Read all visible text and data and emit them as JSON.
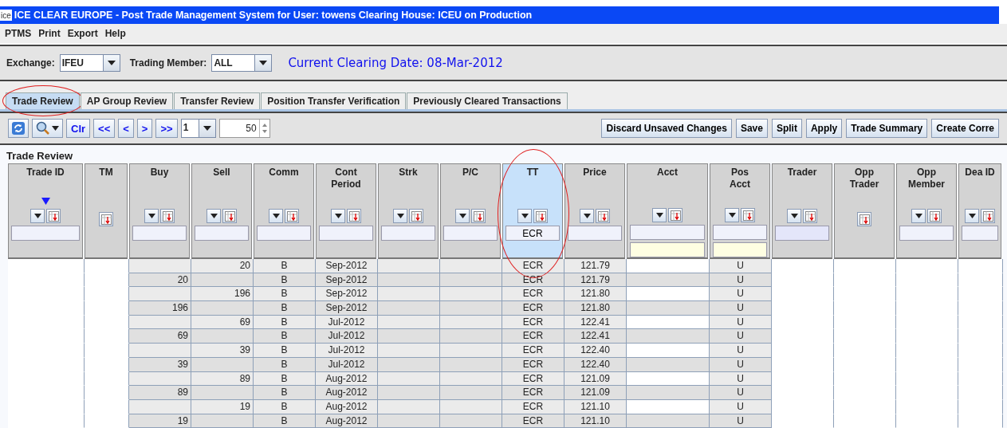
{
  "window": {
    "logo_text": "ice",
    "title": "ICE CLEAR EUROPE - Post Trade Management System for  User: towens Clearing House: ICEU on Production"
  },
  "menu": [
    "PTMS",
    "Print",
    "Export",
    "Help"
  ],
  "filters": {
    "exchange_label": "Exchange:",
    "exchange_value": "IFEU",
    "member_label": "Trading Member:",
    "member_value": "ALL",
    "clearing_date": "Current Clearing Date: 08-Mar-2012"
  },
  "tabs": [
    {
      "label": "Trade Review",
      "selected": true,
      "annotated": true
    },
    {
      "label": "AP Group Review",
      "selected": false,
      "annotated": false
    },
    {
      "label": "Transfer Review",
      "selected": false,
      "annotated": false
    },
    {
      "label": "Position Transfer Verification",
      "selected": false,
      "annotated": false
    },
    {
      "label": "Previously Cleared Transactions",
      "selected": false,
      "annotated": false
    }
  ],
  "toolbar": {
    "nav_buttons": [
      "Clr",
      "<<",
      "<",
      ">",
      ">>"
    ],
    "page": "1",
    "page_size": "50",
    "actions": [
      "Discard Unsaved Changes",
      "Save",
      "Split",
      "Apply",
      "Trade Summary",
      "Create Corre"
    ]
  },
  "panel_title": "Trade Review",
  "columns": [
    {
      "label": "Trade ID",
      "filterable": true,
      "sorted": true,
      "extra_field": false,
      "selected": false,
      "annotated": false
    },
    {
      "label": "TM",
      "filterable": false,
      "sorted": false,
      "extra_field": false,
      "selected": false,
      "annotated": false
    },
    {
      "label": "Buy",
      "filterable": true,
      "sorted": false,
      "extra_field": false,
      "selected": false,
      "annotated": false
    },
    {
      "label": "Sell",
      "filterable": true,
      "sorted": false,
      "extra_field": false,
      "selected": false,
      "annotated": false
    },
    {
      "label": "Comm",
      "filterable": true,
      "sorted": false,
      "extra_field": false,
      "selected": false,
      "annotated": false
    },
    {
      "label": "Cont Period",
      "filterable": true,
      "sorted": false,
      "extra_field": false,
      "selected": false,
      "annotated": false
    },
    {
      "label": "Strk",
      "filterable": true,
      "sorted": false,
      "extra_field": false,
      "selected": false,
      "annotated": false
    },
    {
      "label": "P/C",
      "filterable": true,
      "sorted": false,
      "extra_field": false,
      "selected": false,
      "annotated": false
    },
    {
      "label": "TT",
      "filterable": true,
      "sorted": false,
      "extra_field": false,
      "selected": true,
      "annotated": true,
      "filter_value": "ECR"
    },
    {
      "label": "Price",
      "filterable": true,
      "sorted": false,
      "extra_field": false,
      "selected": false,
      "annotated": false
    },
    {
      "label": "Acct",
      "filterable": true,
      "sorted": false,
      "extra_field": true,
      "selected": false,
      "annotated": false
    },
    {
      "label": "Pos Acct",
      "filterable": true,
      "sorted": false,
      "extra_field": true,
      "selected": false,
      "annotated": false
    },
    {
      "label": "Trader",
      "filterable": true,
      "sorted": false,
      "extra_field": false,
      "selected": false,
      "annotated": false
    },
    {
      "label": "Opp Trader",
      "filterable": false,
      "sorted": false,
      "extra_field": false,
      "selected": false,
      "annotated": false
    },
    {
      "label": "Opp Member",
      "filterable": true,
      "sorted": false,
      "extra_field": false,
      "selected": false,
      "annotated": false
    },
    {
      "label": "Dea ID",
      "filterable": true,
      "sorted": false,
      "extra_field": false,
      "selected": false,
      "annotated": false
    }
  ],
  "rows": [
    {
      "sell": "20",
      "comm": "B",
      "cont_period": "Sep-2012",
      "tt": "ECR",
      "price": "121.79",
      "pos_acct": "U"
    },
    {
      "buy": "20",
      "comm": "B",
      "cont_period": "Sep-2012",
      "tt": "ECR",
      "price": "121.79",
      "pos_acct": "U"
    },
    {
      "sell": "196",
      "comm": "B",
      "cont_period": "Sep-2012",
      "tt": "ECR",
      "price": "121.80",
      "pos_acct": "U"
    },
    {
      "buy": "196",
      "comm": "B",
      "cont_period": "Sep-2012",
      "tt": "ECR",
      "price": "121.80",
      "pos_acct": "U"
    },
    {
      "sell": "69",
      "comm": "B",
      "cont_period": "Jul-2012",
      "tt": "ECR",
      "price": "122.41",
      "pos_acct": "U"
    },
    {
      "buy": "69",
      "comm": "B",
      "cont_period": "Jul-2012",
      "tt": "ECR",
      "price": "122.41",
      "pos_acct": "U"
    },
    {
      "sell": "39",
      "comm": "B",
      "cont_period": "Jul-2012",
      "tt": "ECR",
      "price": "122.40",
      "pos_acct": "U"
    },
    {
      "buy": "39",
      "comm": "B",
      "cont_period": "Jul-2012",
      "tt": "ECR",
      "price": "122.40",
      "pos_acct": "U"
    },
    {
      "sell": "89",
      "comm": "B",
      "cont_period": "Aug-2012",
      "tt": "ECR",
      "price": "121.09",
      "pos_acct": "U"
    },
    {
      "buy": "89",
      "comm": "B",
      "cont_period": "Aug-2012",
      "tt": "ECR",
      "price": "121.09",
      "pos_acct": "U"
    },
    {
      "sell": "19",
      "comm": "B",
      "cont_period": "Aug-2012",
      "tt": "ECR",
      "price": "121.10",
      "pos_acct": "U"
    },
    {
      "buy": "19",
      "comm": "B",
      "cont_period": "Aug-2012",
      "tt": "ECR",
      "price": "121.10",
      "pos_acct": "U"
    }
  ]
}
